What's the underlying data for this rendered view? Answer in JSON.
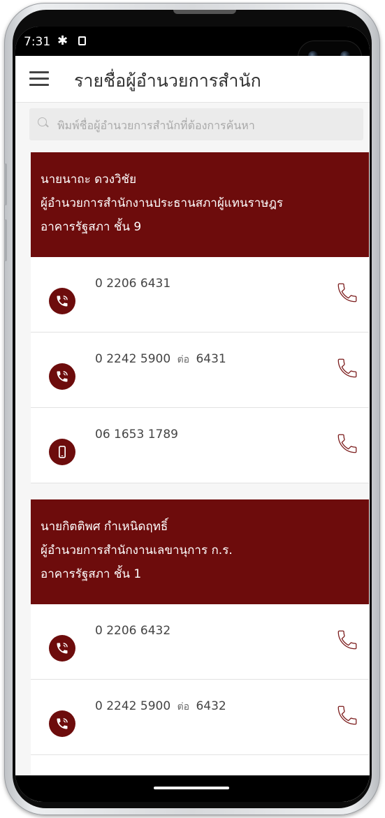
{
  "status_bar": {
    "time": "7:31"
  },
  "app_bar": {
    "title": "รายชื่อผู้อำนวยการสำนัก"
  },
  "search": {
    "placeholder": "พิมพ์ชื่อผู้อำนวยการสำนักที่ต้องการค้นหา",
    "value": ""
  },
  "directors": [
    {
      "name": "นายนาถะ ดวงวิชัย",
      "position": "ผู้อำนวยการสำนักงานประธานสภาผู้แทนราษฎร",
      "location": "อาคารรัฐสภา ชั้น 9",
      "phones": [
        {
          "number": "0 2206 6431",
          "ext_label": "",
          "ext": "",
          "kind": "landline"
        },
        {
          "number": "0 2242 5900",
          "ext_label": "ต่อ",
          "ext": "6431",
          "kind": "landline"
        },
        {
          "number": "06 1653 1789",
          "ext_label": "",
          "ext": "",
          "kind": "mobile"
        }
      ]
    },
    {
      "name": "นายกิตติพศ กำเหนิดฤทธิ์",
      "position": "ผู้อำนวยการสำนักงานเลขานุการ ก.ร.",
      "location": "อาคารรัฐสภา ชั้น 1",
      "phones": [
        {
          "number": "0 2206 6432",
          "ext_label": "",
          "ext": "",
          "kind": "landline"
        },
        {
          "number": "0 2242 5900",
          "ext_label": "ต่อ",
          "ext": "6432",
          "kind": "landline"
        }
      ]
    }
  ],
  "icons": {
    "menu": "hamburger-menu-icon",
    "settings": "gear-icon",
    "sim": "sim-card-icon",
    "search": "search-icon",
    "landline": "phone-ring-icon",
    "mobile": "mobile-phone-icon",
    "call": "call-handset-icon"
  },
  "colors": {
    "brand": "#6d0c0c",
    "background": "#f6f6f6",
    "search_bg": "#ebebeb"
  }
}
